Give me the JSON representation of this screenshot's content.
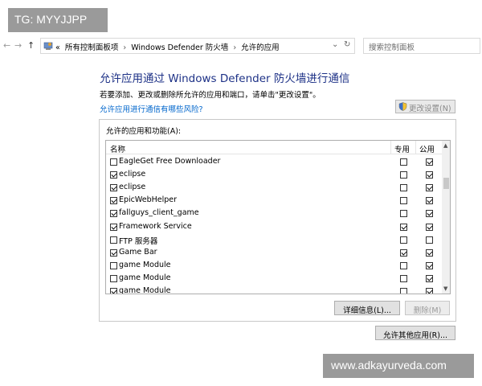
{
  "watermarks": {
    "top_left": "TG: MYYJJPP",
    "bottom_right": "www.adkayurveda.com"
  },
  "address_bar": {
    "back_icon": "back-arrow-icon",
    "forward_icon": "forward-arrow-icon",
    "up_icon": "up-arrow-icon",
    "path_prefix": "«",
    "breadcrumbs": [
      "所有控制面板项",
      "Windows Defender 防火墙",
      "允许的应用"
    ],
    "search_placeholder": "搜索控制面板"
  },
  "page": {
    "title": "允许应用通过 Windows Defender 防火墙进行通信",
    "description": "若要添加、更改或删除所允许的应用和端口，请单击\"更改设置\"。",
    "risk_link": "允许应用进行通信有哪些风险?",
    "change_settings_button": "更改设置(N)"
  },
  "apps_panel": {
    "label": "允许的应用和功能(A):",
    "columns": {
      "name": "名称",
      "private": "专用",
      "public": "公用"
    },
    "rows": [
      {
        "name": "EagleGet Free Downloader",
        "enabled": false,
        "private": false,
        "public": true
      },
      {
        "name": "eclipse",
        "enabled": true,
        "private": false,
        "public": true
      },
      {
        "name": "eclipse",
        "enabled": true,
        "private": false,
        "public": true
      },
      {
        "name": "EpicWebHelper",
        "enabled": true,
        "private": false,
        "public": true
      },
      {
        "name": "fallguys_client_game",
        "enabled": true,
        "private": false,
        "public": true
      },
      {
        "name": "Framework Service",
        "enabled": true,
        "private": true,
        "public": true
      },
      {
        "name": "FTP 服务器",
        "enabled": false,
        "private": false,
        "public": false
      },
      {
        "name": "Game Bar",
        "enabled": true,
        "private": true,
        "public": true
      },
      {
        "name": "game Module",
        "enabled": false,
        "private": false,
        "public": true
      },
      {
        "name": "game Module",
        "enabled": false,
        "private": false,
        "public": true
      },
      {
        "name": "game Module",
        "enabled": true,
        "private": false,
        "public": true
      }
    ],
    "details_button": "详细信息(L)...",
    "remove_button": "删除(M)"
  },
  "allow_other_button": "允许其他应用(R)..."
}
